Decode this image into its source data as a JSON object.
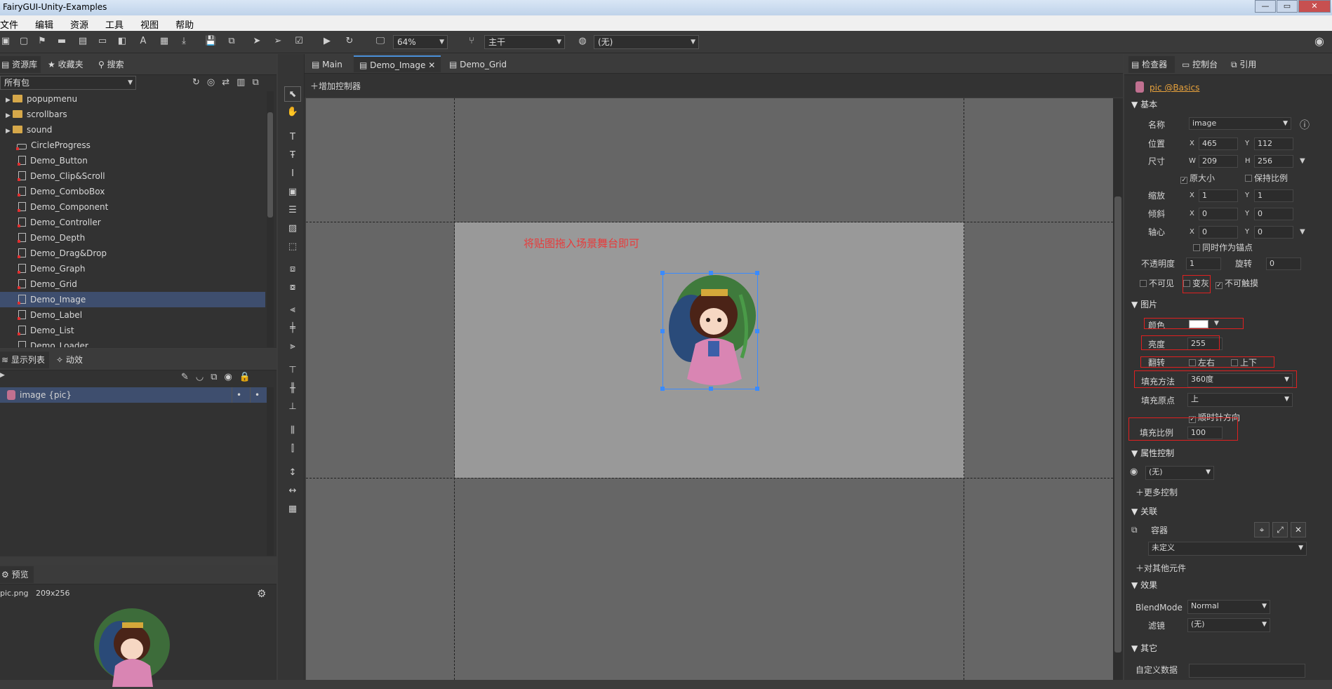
{
  "window": {
    "title": "FairyGUI-Unity-Examples",
    "min": "—",
    "max": "▭",
    "close": "✕"
  },
  "menu": [
    "文件",
    "编辑",
    "资源",
    "工具",
    "视图",
    "帮助"
  ],
  "toolbar": {
    "zoom": "64%",
    "branch": "主干",
    "lang": "(无)"
  },
  "library": {
    "tabs": {
      "assets": "资源库",
      "favorites": "收藏夹",
      "search": "搜索"
    },
    "package_filter": "所有包",
    "items": [
      {
        "label": "popupmenu",
        "type": "folder"
      },
      {
        "label": "scrollbars",
        "type": "folder"
      },
      {
        "label": "sound",
        "type": "folder"
      },
      {
        "label": "CircleProgress",
        "type": "component"
      },
      {
        "label": "Demo_Button",
        "type": "file"
      },
      {
        "label": "Demo_Clip&Scroll",
        "type": "file"
      },
      {
        "label": "Demo_ComboBox",
        "type": "file"
      },
      {
        "label": "Demo_Component",
        "type": "file"
      },
      {
        "label": "Demo_Controller",
        "type": "file"
      },
      {
        "label": "Demo_Depth",
        "type": "file"
      },
      {
        "label": "Demo_Drag&Drop",
        "type": "file"
      },
      {
        "label": "Demo_Graph",
        "type": "file"
      },
      {
        "label": "Demo_Grid",
        "type": "file"
      },
      {
        "label": "Demo_Image",
        "type": "file",
        "selected": true
      },
      {
        "label": "Demo_Label",
        "type": "file"
      },
      {
        "label": "Demo_List",
        "type": "file"
      },
      {
        "label": "Demo_Loader",
        "type": "file"
      }
    ]
  },
  "display": {
    "tabs": {
      "list": "显示列表",
      "effect": "动效"
    },
    "item": "image {pic}"
  },
  "preview": {
    "title": "预览",
    "file": "pic.png",
    "size": "209x256"
  },
  "editor": {
    "tabs": [
      {
        "label": "Main",
        "active": false,
        "close": ""
      },
      {
        "label": "Demo_Image",
        "active": true,
        "close": "✕"
      },
      {
        "label": "Demo_Grid",
        "active": false,
        "close": ""
      }
    ],
    "add_controller": "增加控制器",
    "stage_text": "将贴图拖入场景舞台即可"
  },
  "inspector": {
    "tabs": {
      "inspector": "检查器",
      "console": "控制台",
      "ref": "引用"
    },
    "object": "pic @Basics",
    "sec_basic": "基本",
    "name_label": "名称",
    "name_value": "image",
    "pos_label": "位置",
    "pos_x": "465",
    "pos_y": "112",
    "size_label": "尺寸",
    "size_w": "209",
    "size_h": "256",
    "orig_size": "原大小",
    "keep_ratio": "保持比例",
    "scale_label": "缩放",
    "scale_x": "1",
    "scale_y": "1",
    "skew_label": "倾斜",
    "skew_x": "0",
    "skew_y": "0",
    "pivot_label": "轴心",
    "pivot_x": "0",
    "pivot_y": "0",
    "as_anchor": "同时作为锚点",
    "alpha_label": "不透明度",
    "alpha_value": "1",
    "rotation_label": "旋转",
    "rotation_value": "0",
    "invisible": "不可见",
    "grayed": "变灰",
    "untouchable": "不可触摸",
    "sec_image": "图片",
    "color_label": "颜色",
    "color_value": "#ffffff",
    "bright_label": "亮度",
    "bright_value": "255",
    "flip_label": "翻转",
    "flip_h": "左右",
    "flip_v": "上下",
    "fill_method_label": "填充方法",
    "fill_method_value": "360度",
    "fill_origin_label": "填充原点",
    "fill_origin_value": "上",
    "clockwise": "顺时针方向",
    "fill_amount_label": "填充比例",
    "fill_amount_value": "100",
    "sec_gear": "属性控制",
    "gear_value": "(无)",
    "more_ctrl": "更多控制",
    "sec_relation": "关联",
    "relation_target": "容器",
    "relation_value": "未定义",
    "relation_other": "对其他元件",
    "sec_effect": "效果",
    "blend_label": "BlendMode",
    "blend_value": "Normal",
    "filter_label": "滤镜",
    "filter_value": "(无)",
    "sec_other": "其它",
    "custom_data": "自定义数据",
    "x": "X",
    "y": "Y",
    "w": "W",
    "h": "H"
  }
}
